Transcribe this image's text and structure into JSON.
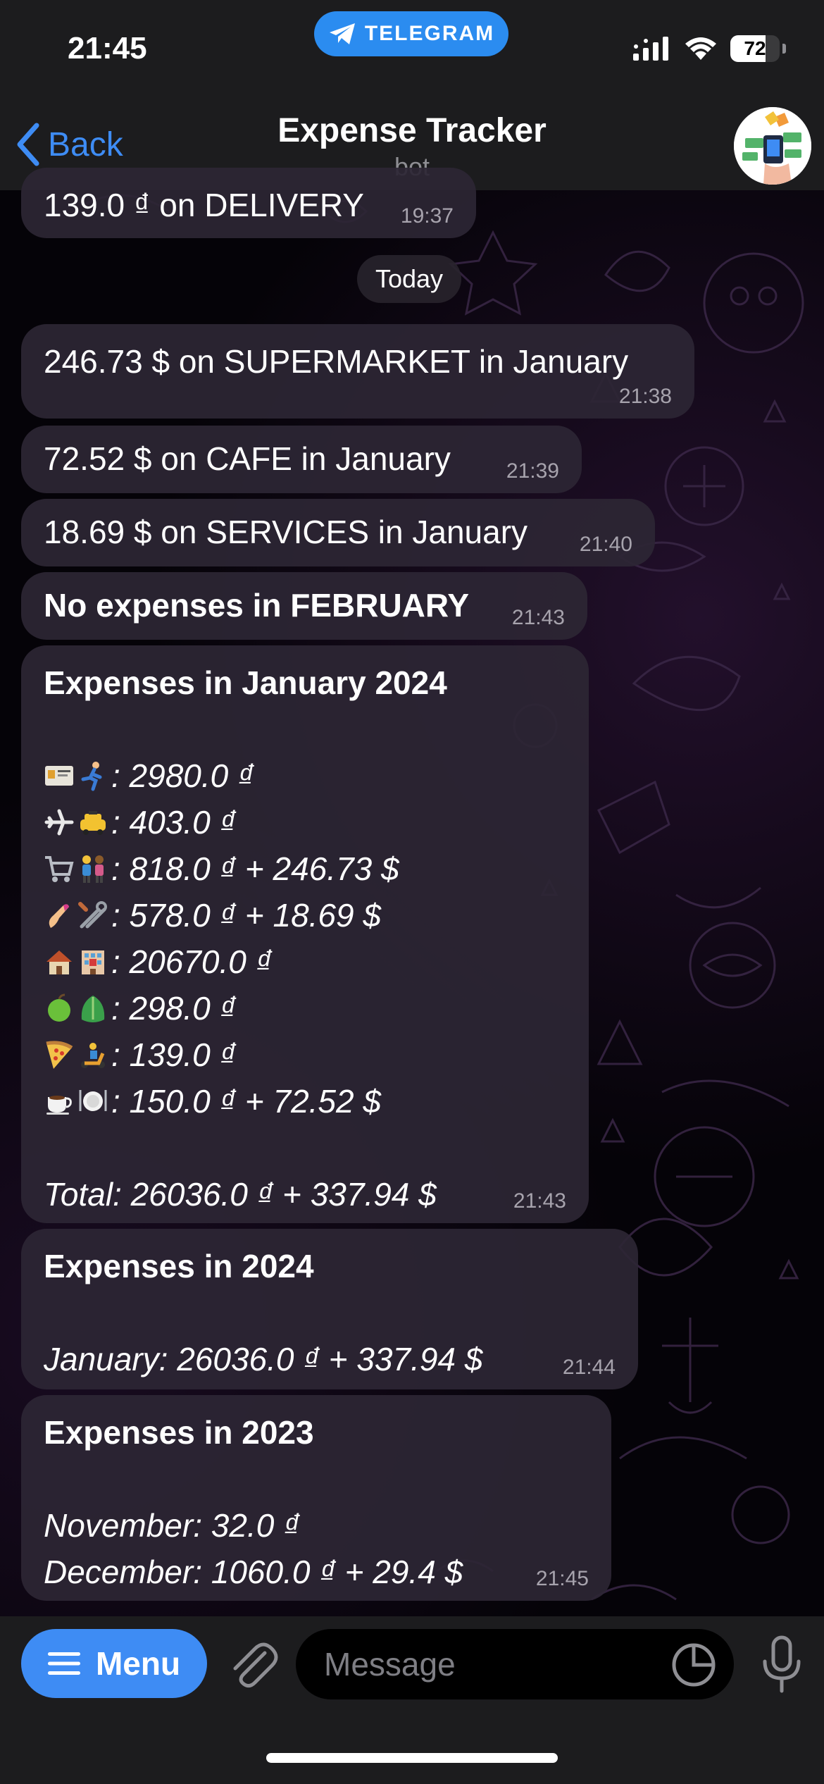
{
  "status_bar": {
    "time": "21:45",
    "app_pill": "TELEGRAM",
    "battery": "72",
    "battery_level": 0.72
  },
  "header": {
    "back_label": "Back",
    "title": "Expense Tracker",
    "subtitle": "bot"
  },
  "date_separator": "Today",
  "messages": {
    "m0": {
      "text": "139.0 ₫ on DELIVERY",
      "time": "19:37"
    },
    "m1": {
      "text": "246.73 $ on SUPERMARKET in January",
      "time": "21:38"
    },
    "m2": {
      "text": "72.52 $ on CAFE in January",
      "time": "21:39"
    },
    "m3": {
      "text": "18.69 $ on SERVICES in January",
      "time": "21:40"
    },
    "m4": {
      "text": "No expenses in FEBRUARY",
      "time": "21:43"
    },
    "m5": {
      "title": "Expenses in January 2024",
      "rows": [
        {
          "icons": [
            "id-card-icon",
            "runner-icon"
          ],
          "value": ": 2980.0 ₫"
        },
        {
          "icons": [
            "airplane-icon",
            "taxi-icon"
          ],
          "value": ": 403.0 ₫"
        },
        {
          "icons": [
            "shopping-cart-icon",
            "couple-icon"
          ],
          "value": ": 818.0 ₫ + 246.73 $"
        },
        {
          "icons": [
            "nail-polish-icon",
            "tools-icon"
          ],
          "value": ": 578.0 ₫ + 18.69 $"
        },
        {
          "icons": [
            "house-icon",
            "hotel-icon"
          ],
          "value": ": 20670.0 ₫"
        },
        {
          "icons": [
            "apple-icon",
            "lettuce-icon"
          ],
          "value": ": 298.0 ₫"
        },
        {
          "icons": [
            "pizza-icon",
            "scooter-icon"
          ],
          "value": ": 139.0 ₫"
        },
        {
          "icons": [
            "coffee-icon",
            "plate-icon"
          ],
          "value": ": 150.0 ₫ + 72.52 $"
        }
      ],
      "total": "Total: 26036.0 ₫ + 337.94 $",
      "time": "21:43"
    },
    "m6": {
      "title": "Expenses in 2024",
      "lines": [
        "January: 26036.0 ₫ + 337.94 $"
      ],
      "time": "21:44"
    },
    "m7": {
      "title": "Expenses in 2023",
      "lines": [
        "November: 32.0 ₫",
        "December: 1060.0 ₫ + 29.4 $"
      ],
      "time": "21:45"
    }
  },
  "input_bar": {
    "menu_label": "Menu",
    "placeholder": "Message"
  },
  "colors": {
    "accent": "#3e8cf4",
    "telegram_pill": "#2b8cf0",
    "bubble": "#2c2634",
    "bar": "#1c1c1e"
  }
}
